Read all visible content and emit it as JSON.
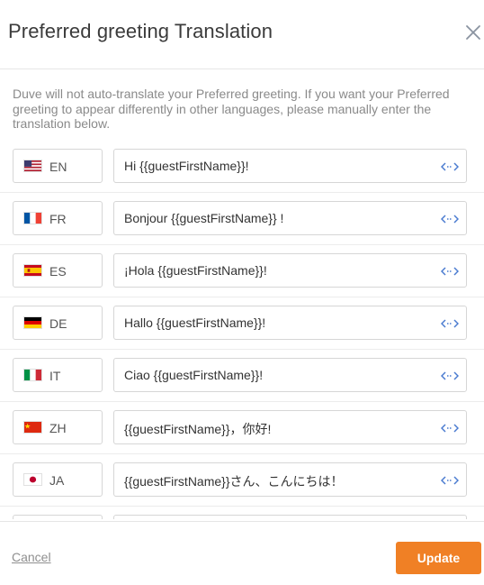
{
  "modal": {
    "title": "Preferred greeting Translation",
    "close_icon": "close-icon",
    "description": "Duve will not auto-translate your Preferred greeting. If you want your Preferred greeting to appear differently in other languages, please manually enter the translation below."
  },
  "rows": [
    {
      "code": "EN",
      "flag": "us-flag-icon",
      "value": "Hi {{guestFirstName}}!"
    },
    {
      "code": "FR",
      "flag": "france-flag-icon",
      "value": "Bonjour {{guestFirstName}} !"
    },
    {
      "code": "ES",
      "flag": "spain-flag-icon",
      "value": "¡Hola {{guestFirstName}}!"
    },
    {
      "code": "DE",
      "flag": "germany-flag-icon",
      "value": "Hallo {{guestFirstName}}!"
    },
    {
      "code": "IT",
      "flag": "italy-flag-icon",
      "value": "Ciao {{guestFirstName}}!"
    },
    {
      "code": "ZH",
      "flag": "china-flag-icon",
      "value": "{{guestFirstName}}，你好!"
    },
    {
      "code": "JA",
      "flag": "japan-flag-icon",
      "value": "{{guestFirstName}}さん、こんにちは！"
    }
  ],
  "footer": {
    "cancel_label": "Cancel",
    "update_label": "Update"
  },
  "colors": {
    "accent": "#f08025",
    "variable_icon": "#4a7bd0"
  }
}
